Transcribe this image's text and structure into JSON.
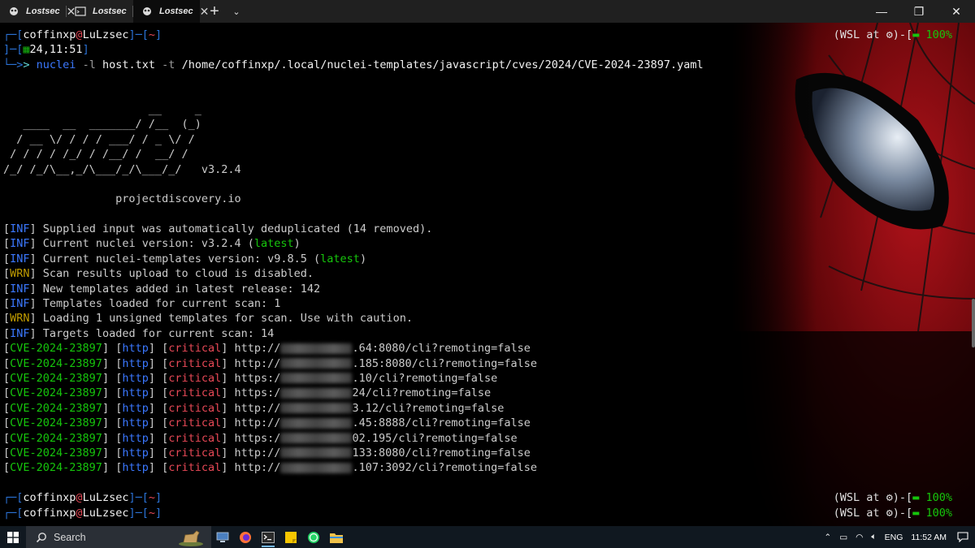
{
  "tabs": [
    {
      "label": "Lostsec",
      "icon": "spider-logo-icon",
      "close": "✕"
    },
    {
      "label": "Lostsec",
      "icon": "terminal-icon",
      "close": "✕"
    },
    {
      "label": "Lostsec",
      "icon": "spider-logo-icon",
      "close": "✕"
    }
  ],
  "titlebar": {
    "new_tab": "+",
    "dropdown": "⌄",
    "minimize": "—",
    "maximize": "❐",
    "close": "✕"
  },
  "terminal": {
    "prompt1": {
      "user": "coffinxp",
      "at": "@",
      "host": "LuLzsec",
      "dir": "~"
    },
    "wsl_status": {
      "text": "(WSL at ⚙)-[",
      "batt": "▬",
      "pct": "100%",
      "end": ""
    },
    "time_line": {
      "date": "24,11:51"
    },
    "command": {
      "cmd": "nuclei",
      "flag1": "-l",
      "arg1": "host.txt",
      "flag2": "-t",
      "arg2": "/home/coffinxp/.local/nuclei-templates/javascript/cves/2024/CVE-2024-23897.yaml"
    },
    "ascii": [
      "                      __     _",
      "   ____  __  _______/ /__  (_)",
      "  / __ \\/ / / / ___/ / _ \\/ /",
      " / / / / /_/ / /__/ /  __/ /",
      "/_/ /_/\\__,_/\\___/_/\\___/_/   v3.2.4"
    ],
    "site": "projectdiscovery.io",
    "logs": [
      {
        "tag": "INF",
        "text": "Supplied input was automatically deduplicated (14 removed)."
      },
      {
        "tag": "INF",
        "text": "Current nuclei version: v3.2.4 (",
        "hl": "latest",
        "tail": ")"
      },
      {
        "tag": "INF",
        "text": "Current nuclei-templates version: v9.8.5 (",
        "hl": "latest",
        "tail": ")"
      },
      {
        "tag": "WRN",
        "text": "Scan results upload to cloud is disabled."
      },
      {
        "tag": "INF",
        "text": "New templates added in latest release: 142"
      },
      {
        "tag": "INF",
        "text": "Templates loaded for current scan: 1"
      },
      {
        "tag": "WRN",
        "text": "Loading 1 unsigned templates for scan. Use with caution."
      },
      {
        "tag": "INF",
        "text": "Targets loaded for current scan: 14"
      }
    ],
    "results": [
      {
        "id": "CVE-2024-23897",
        "proto": "http",
        "sev": "critical",
        "pre": "http://",
        "post": ".64:8080/cli?remoting=false"
      },
      {
        "id": "CVE-2024-23897",
        "proto": "http",
        "sev": "critical",
        "pre": "http://",
        "post": ".185:8080/cli?remoting=false"
      },
      {
        "id": "CVE-2024-23897",
        "proto": "http",
        "sev": "critical",
        "pre": "https:/",
        "post": ".10/cli?remoting=false"
      },
      {
        "id": "CVE-2024-23897",
        "proto": "http",
        "sev": "critical",
        "pre": "https:/",
        "post": "24/cli?remoting=false"
      },
      {
        "id": "CVE-2024-23897",
        "proto": "http",
        "sev": "critical",
        "pre": "http://",
        "post": "3.12/cli?remoting=false"
      },
      {
        "id": "CVE-2024-23897",
        "proto": "http",
        "sev": "critical",
        "pre": "http://",
        "post": ".45:8888/cli?remoting=false"
      },
      {
        "id": "CVE-2024-23897",
        "proto": "http",
        "sev": "critical",
        "pre": "https:/",
        "post": "02.195/cli?remoting=false"
      },
      {
        "id": "CVE-2024-23897",
        "proto": "http",
        "sev": "critical",
        "pre": "http://",
        "post": "133:8080/cli?remoting=false"
      },
      {
        "id": "CVE-2024-23897",
        "proto": "http",
        "sev": "critical",
        "pre": "http://",
        "post": ".107:3092/cli?remoting=false"
      }
    ]
  },
  "taskbar": {
    "search_label": "Search",
    "language": "ENG",
    "time": "11:52 AM"
  },
  "colors": {
    "red": "#e74856",
    "green": "#13a10e",
    "blue": "#3b78ff",
    "yellow": "#c19c00"
  }
}
